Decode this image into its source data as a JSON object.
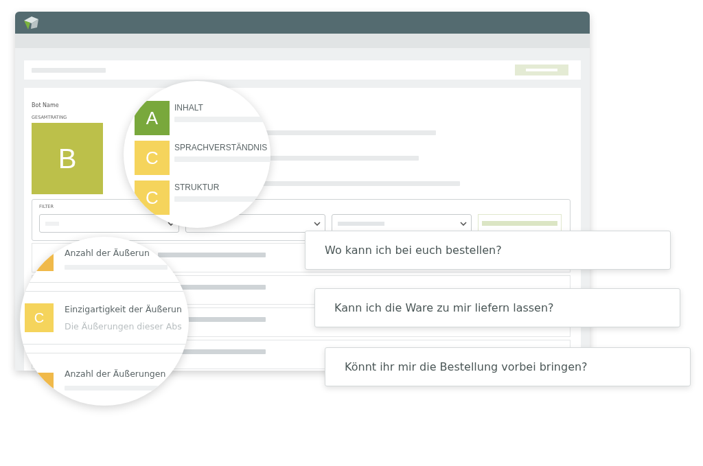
{
  "bot_name_label": "Bot Name",
  "overall_rating": {
    "label": "GESAMTRATING",
    "grade": "B",
    "color": "#bcc04a"
  },
  "categories": [
    {
      "grade": "A",
      "label": "INHALT",
      "color": "#79a83c"
    },
    {
      "grade": "C",
      "label": "SPRACHVERSTÄNDNIS",
      "color": "#f5d45c"
    },
    {
      "grade": "C",
      "label": "STRUKTUR",
      "color": "#f5d45c"
    }
  ],
  "filter": {
    "label": "FILTER"
  },
  "magnified_rows": [
    {
      "kind": "partial",
      "title": "Anzahl der Äußerun",
      "color": "#f0b94a"
    },
    {
      "kind": "full",
      "grade": "C",
      "title": "Einzigartigkeit der Äußerun",
      "description": "Die Äußerungen dieser Abs",
      "color": "#f5d45c"
    },
    {
      "kind": "partial",
      "title": "Anzahl der Äußerungen",
      "color": "#f0b94a"
    }
  ],
  "questions": [
    "Wo kann ich bei euch bestellen?",
    "Kann ich die Ware zu mir liefern lassen?",
    "Könnt ihr mir die Bestellung vorbei bringen?"
  ]
}
